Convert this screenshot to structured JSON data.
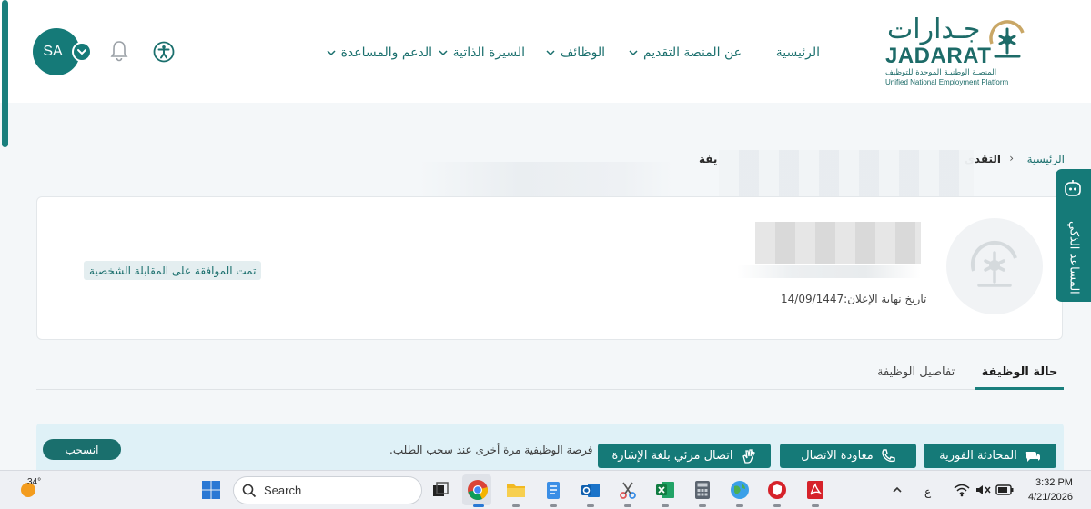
{
  "header": {
    "avatar_initials": "SA",
    "nav": {
      "home": "الرئيسية",
      "about": "عن المنصة",
      "apply": "التقديم",
      "jobs": "الوظائف",
      "cv": "السيرة الذاتية",
      "support": "الدعم والمساعدة"
    },
    "logo": {
      "arabic": "جـدارات",
      "english": "JADARAT",
      "sub_ar": "المنصـة الوطنيـة الموحدة للتوظيف",
      "sub_en": "Unified National Employment Platform"
    }
  },
  "breadcrumb": {
    "home": "الرئيسية",
    "separator": "›",
    "apply": "التقدي",
    "job": "يفة"
  },
  "job_card": {
    "status": "تمت الموافقة على المقابلة الشخصية",
    "deadline": "تاريخ نهاية الإعلان:14/09/1447"
  },
  "tabs": {
    "status": "حالة الوظيفة",
    "details": "تفاصيل الوظيفة"
  },
  "notice": {
    "withdraw_label": "انسحب",
    "text": "فرصة الوظيفية مرة أخرى عند سحب الطلب."
  },
  "floating": {
    "chat": "المحادثة الفورية",
    "callback": "معاودة الاتصال",
    "sign_language": "اتصال مرئي بلغة الإشارة"
  },
  "assistant": {
    "label": "المساعد الذكي"
  },
  "taskbar": {
    "temperature": "34°",
    "search_placeholder": "Search",
    "lang": "ع",
    "time": "3:32 PM",
    "date": "4/21/2026"
  },
  "colors": {
    "primary": "#157a78",
    "accent_light": "#dff1f7"
  }
}
